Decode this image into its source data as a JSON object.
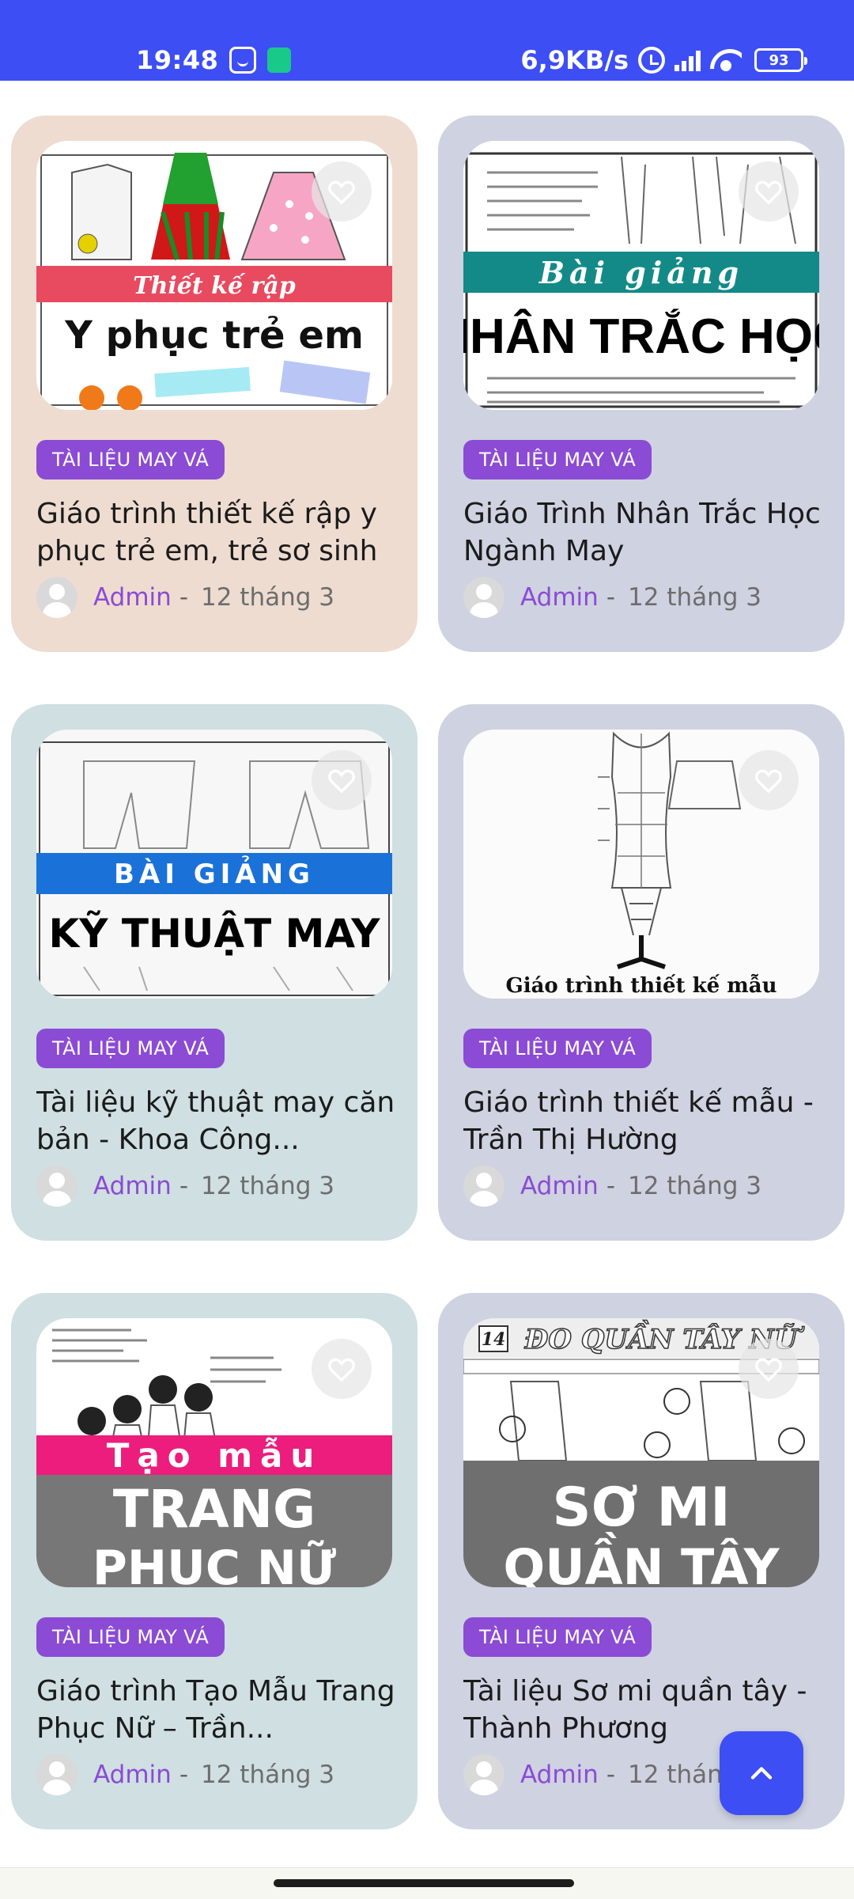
{
  "status_bar": {
    "time": "19:48",
    "speed": "6,9KB/s",
    "battery": "93",
    "color": "#3d4ef5"
  },
  "cards": [
    {
      "thumb_lines": [
        "Thiết kế rập",
        "Y phục trẻ em"
      ],
      "tag": "TÀI LIỆU MAY VÁ",
      "title": "Giáo trình thiết kế rập y phục trẻ em, trẻ sơ sinh",
      "author": "Admin",
      "separator": "-",
      "date": "12 tháng 3",
      "bg": "#eedcd0"
    },
    {
      "thumb_lines": [
        "Bài giảng",
        "NHÂN TRẮC HỌC"
      ],
      "tag": "TÀI LIỆU MAY VÁ",
      "title": "Giáo Trình Nhân Trắc Học Ngành May",
      "author": "Admin",
      "separator": "-",
      "date": "12 tháng 3",
      "bg": "#ced2e1"
    },
    {
      "thumb_lines": [
        "BÀI GIẢNG",
        "KỸ THUẬT MAY"
      ],
      "tag": "TÀI LIỆU MAY VÁ",
      "title": "Tài liệu kỹ thuật may căn bản - Khoa Công...",
      "author": "Admin",
      "separator": "-",
      "date": "12 tháng 3",
      "bg": "#cfdfe2"
    },
    {
      "thumb_lines": [
        "Giáo trình thiết kế mẫu"
      ],
      "tag": "TÀI LIỆU MAY VÁ",
      "title": "Giáo trình thiết kế mẫu - Trần Thị Hường",
      "author": "Admin",
      "separator": "-",
      "date": "12 tháng 3",
      "bg": "#ced2e1"
    },
    {
      "thumb_lines": [
        "Tạo mẫu",
        "TRANG",
        "PHỤC NỮ"
      ],
      "tag": "TÀI LIỆU MAY VÁ",
      "title": "Giáo trình Tạo Mẫu Trang Phục Nữ – Trần...",
      "author": "Admin",
      "separator": "-",
      "date": "12 tháng 3",
      "bg": "#cfdfe2"
    },
    {
      "thumb_lines": [
        "14",
        "ĐO QUẦN TÂY NỮ",
        "SƠ MI",
        "QUẦN TÂY"
      ],
      "tag": "TÀI LIỆU MAY VÁ",
      "title": "Tài liệu Sơ mi quần tây - Thành Phương",
      "author": "Admin",
      "separator": "-",
      "date": "12 tháng 3",
      "bg": "#ced2e1"
    }
  ],
  "accent_colors": {
    "tag": "#8b4bd4",
    "author": "#8b4bd4",
    "scroll_top_button": "#3d4ef5"
  },
  "icons": {
    "favorite": "heart-outline-icon",
    "scroll_top": "chevron-up-icon",
    "avatar": "default-user-avatar"
  }
}
